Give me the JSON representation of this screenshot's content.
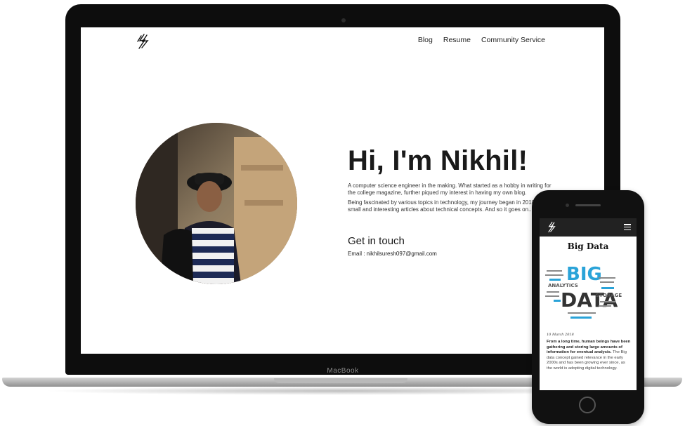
{
  "laptop": {
    "device_label": "MacBook",
    "site": {
      "logo_icon": "lightning-logo-icon",
      "nav": [
        {
          "label": "Blog"
        },
        {
          "label": "Resume"
        },
        {
          "label": "Community Service"
        }
      ],
      "hero": {
        "title": "Hi, I'm Nikhil!",
        "paragraph_1": "A computer science engineer in the making. What started as a hobby in writing for the college magazine, further piqued my interest in having my own blog.",
        "paragraph_2": "Being fascinated by various topics in technology, my journey began in 2018, writing small and interesting articles about technical concepts. And so it goes on....",
        "contact_heading": "Get in touch",
        "email_label": "Email : ",
        "email": "nikhilsuresh097@gmail.com"
      }
    }
  },
  "phone": {
    "nav": {
      "logo_icon": "lightning-logo-icon",
      "menu_icon": "hamburger-menu-icon"
    },
    "post": {
      "title": "Big Data",
      "image_words": [
        "BIG",
        "DATA",
        "ANALYTICS",
        "STORAGE"
      ],
      "date": "10 March 2018",
      "intro_bold": "From a long time, human beings have been gathering and storing large amounts of information for eventual analysis.",
      "intro_rest": " The Big data concept gained relevance in the early 2000s and has been growing ever since, as the world is adopting digital technology."
    }
  }
}
